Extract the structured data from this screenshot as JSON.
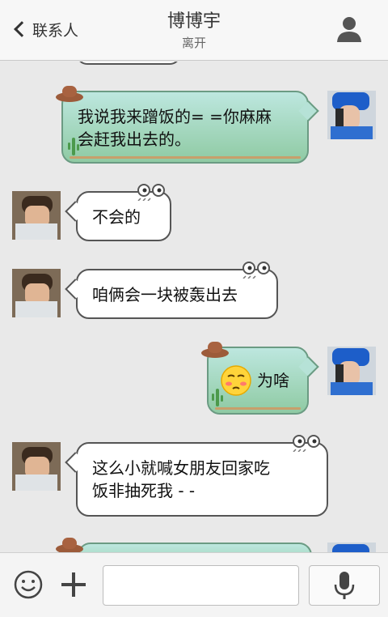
{
  "header": {
    "back_label": "联系人",
    "title": "博博宇",
    "status": "离开",
    "back_icon": "chevron-left-icon",
    "profile_icon": "person-icon"
  },
  "messages": [
    {
      "side": "right",
      "text": "我说我来蹭饭的= =你麻麻\n会赶我出去的。"
    },
    {
      "side": "left",
      "text": "不会的"
    },
    {
      "side": "left",
      "text": "咱俩会一块被轰出去"
    },
    {
      "side": "right",
      "emoji": "embarrassed-face-emoji",
      "text": "为啥"
    },
    {
      "side": "left",
      "text": "这么小就喊女朋友回家吃\n饭非抽死我 - -"
    }
  ],
  "input_bar": {
    "emoji_icon": "smiley-icon",
    "plus_icon": "plus-icon",
    "input_value": "",
    "voice_icon": "microphone-icon"
  },
  "colors": {
    "header_bg": "#f7f7f7",
    "chat_bg": "#e9e9e9",
    "outgoing_bubble": "#a9d9c4",
    "incoming_bubble": "#ffffff",
    "bubble_border": "#555555"
  }
}
